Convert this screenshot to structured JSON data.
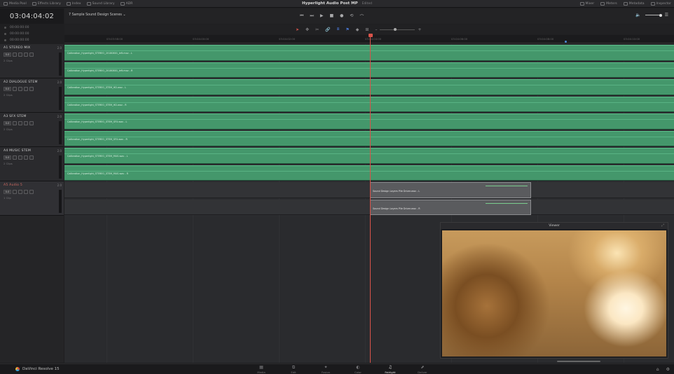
{
  "menu": {
    "left": [
      {
        "label": "Media Pool",
        "icon": "media-pool-icon"
      },
      {
        "label": "Effects Library",
        "icon": "effects-icon"
      },
      {
        "label": "Index",
        "icon": "index-icon"
      },
      {
        "label": "Sound Library",
        "icon": "sound-library-icon"
      },
      {
        "label": "ADR",
        "icon": "adr-icon"
      }
    ],
    "project_title": "Hyperlight Audio Post MP",
    "project_status": "Edited",
    "right": [
      {
        "label": "Mixer",
        "icon": "mixer-icon"
      },
      {
        "label": "Meters",
        "icon": "meters-icon"
      },
      {
        "label": "Metadata",
        "icon": "metadata-icon"
      },
      {
        "label": "Inspector",
        "icon": "inspector-icon"
      }
    ]
  },
  "header": {
    "timecode": "03:04:04:02",
    "timeline_name": "7 Sample Sound Design Scenes",
    "tc_rows": [
      "00:00:00:00",
      "00:00:00:00",
      "00:00:00:00"
    ],
    "transport": [
      "⏮",
      "⏭",
      "▶",
      "■",
      "●",
      "⟲",
      "⌒"
    ],
    "volume_icon": "🔈",
    "menu_icon": "☰"
  },
  "ruler": {
    "ticks": [
      "03:03:58:00",
      "03:04:00:00",
      "03:04:02:00",
      "03:04:04:00",
      "03:04:06:00",
      "03:04:08:00",
      "03:04:10:00"
    ]
  },
  "tracks": [
    {
      "id": "A1",
      "name": "STEREO MIX",
      "chn": "2.0",
      "vol": "0.0",
      "clips": "2 Clips",
      "clip_labels": [
        "Calibration_Hyperlight_STEREO_20180801_left.mov - L",
        "Calibration_Hyperlight_STEREO_20180801_left.mov - R"
      ]
    },
    {
      "id": "A2",
      "name": "DIALOGUE STEM",
      "chn": "2.0",
      "vol": "0.0",
      "clips": "2 Clips",
      "clip_labels": [
        "Calibration_Hyperlight_STEREO_STEM_HD.wav - L",
        "Calibration_Hyperlight_STEREO_STEM_HD.wav - R"
      ]
    },
    {
      "id": "A3",
      "name": "SFX STEM",
      "chn": "2.0",
      "vol": "0.0",
      "clips": "2 Clips",
      "clip_labels": [
        "Calibration_Hyperlight_STEREO_STEM_SFX.wav - L",
        "Calibration_Hyperlight_STEREO_STEM_SFX.wav - R"
      ]
    },
    {
      "id": "A4",
      "name": "MUSIC STEM",
      "chn": "2.0",
      "vol": "0.0",
      "clips": "2 Clips",
      "clip_labels": [
        "Calibration_Hyperlight_STEREO_STEM_MUS.wav - L",
        "Calibration_Hyperlight_STEREO_STEM_MUS.wav - R"
      ]
    },
    {
      "id": "A5",
      "name": "Audio 5",
      "chn": "2.0",
      "vol": "0.0",
      "clips": "1 Clip",
      "clip_labels": [
        "Sound Design Layers Pile Driver.wav - L",
        "Sound Design Layers Pile Driver.wav - R"
      ]
    }
  ],
  "viewer": {
    "title": "Viewer"
  },
  "footer": {
    "brand": "DaVinci Resolve 15",
    "pages": [
      {
        "label": "Media",
        "icon": "▦"
      },
      {
        "label": "Edit",
        "icon": "⧉"
      },
      {
        "label": "Fusion",
        "icon": "✦"
      },
      {
        "label": "Color",
        "icon": "◐"
      },
      {
        "label": "Fairlight",
        "icon": "♫"
      },
      {
        "label": "Deliver",
        "icon": "⬈"
      }
    ],
    "active_page": "Fairlight"
  },
  "colors": {
    "clip_green": "#44976b",
    "playhead": "#d9534a",
    "accent_blue": "#4a78d6"
  }
}
